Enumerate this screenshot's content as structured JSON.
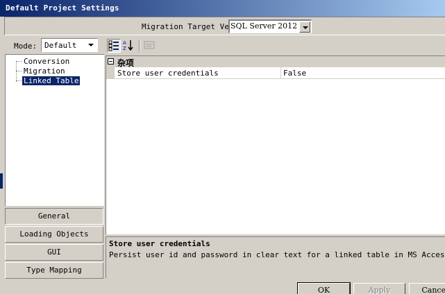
{
  "window": {
    "title": "Default Project Settings"
  },
  "target": {
    "label": "Migration Target Vers",
    "value": "SQL Server 2012"
  },
  "mode": {
    "label": "Mode:",
    "value": "Default"
  },
  "tree": {
    "items": [
      {
        "label": "Conversion"
      },
      {
        "label": "Migration"
      },
      {
        "label": "Linked Table",
        "selected": true
      }
    ]
  },
  "nav": {
    "items": [
      {
        "label": "General",
        "active": true
      },
      {
        "label": "Loading Objects"
      },
      {
        "label": "GUI"
      },
      {
        "label": "Type Mapping"
      }
    ]
  },
  "toolbar": {
    "buttons": [
      {
        "icon": "categorized-icon",
        "pressed": true
      },
      {
        "icon": "sort-alphabetical-icon"
      },
      {
        "icon": "property-pages-icon",
        "disabled": true
      }
    ]
  },
  "property_grid": {
    "category": "杂项",
    "rows": [
      {
        "name": "Store user credentials",
        "value": "False"
      }
    ]
  },
  "help": {
    "title": "Store user credentials",
    "description": "Persist user id and password in clear text for a linked table in MS Access."
  },
  "buttons": {
    "ok": "OK",
    "apply": "Apply",
    "cancel": "Cancel"
  },
  "colors": {
    "titlebar": "#0a246a",
    "face": "#d4d0c8",
    "selection": "#0a246a"
  }
}
